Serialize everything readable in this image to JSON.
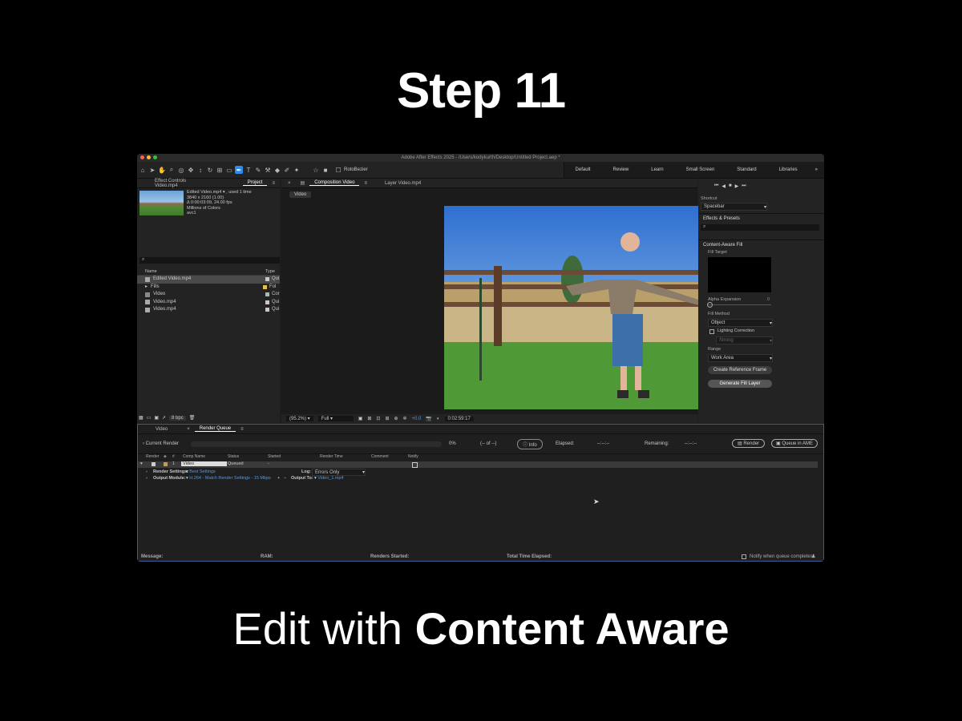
{
  "step_title": "Step 11",
  "caption": {
    "regular": "Edit with",
    "bold": "Content Aware"
  },
  "app": {
    "title": "Adobe After Effects 2025 - /Users/kodykurth/Desktop/Untitled Project.aep *",
    "toolbar": {
      "roto_label": "RotoBezier"
    },
    "workspaces": [
      "Default",
      "Review",
      "Learn",
      "Small Screen",
      "Standard",
      "Libraries"
    ],
    "project_panel": {
      "tabs": [
        "Effect Controls Video.mp4",
        "Project"
      ],
      "thumb_name": "Edited Video.mp4 ▾ , used 1 time",
      "thumb_info": [
        "3840 x 2160 (1.00)",
        "Δ 0:00:03:09, 24.00 fps",
        "Millions of Colors",
        "avc1"
      ],
      "col_name": "Name",
      "col_type": "Type",
      "items": [
        {
          "name": "Edited Video.mp4",
          "type": "Qui",
          "color": "#c8c8c8"
        },
        {
          "name": "Fills",
          "type": "Fol",
          "color": "#e2c24a"
        },
        {
          "name": "Video",
          "type": "Cor",
          "color": "#9ec0a6"
        },
        {
          "name": "Video.mp4",
          "type": "Qui",
          "color": "#c8c8c8"
        },
        {
          "name": "Video.mp4",
          "type": "Qui",
          "color": "#c8c8c8"
        }
      ],
      "bpc": "8 bpc"
    },
    "comp_panel": {
      "tabs": [
        "Composition Video",
        "Layer Video.mp4"
      ],
      "breadcrumb": "Video",
      "zoom": "(95.2%)",
      "quality": "Full",
      "exposure": "+0.0",
      "timecode": "0:02:59:17"
    },
    "right_panel": {
      "shortcut_label": "Shortcut",
      "shortcut_value": "Spacebar",
      "effects_title": "Effects & Presets",
      "caf_title": "Content-Aware Fill",
      "fill_target": "Fill Target",
      "alpha_expansion": "Alpha Expansion",
      "alpha_value": "0",
      "fill_method_label": "Fill Method",
      "fill_method": "Object",
      "lighting": "Lighting Correction",
      "strength": "Strong",
      "range_label": "Range",
      "range": "Work Area",
      "create_ref": "Create Reference Frame",
      "generate": "Generate Fill Layer"
    },
    "render_queue": {
      "tabs": [
        "Video",
        "Render Queue"
      ],
      "current_render": "Current Render",
      "percent": "0%",
      "of": "(-- of --)",
      "info": "Info",
      "elapsed_label": "Elapsed:",
      "elapsed_value": "--:--:--",
      "remaining_label": "Remaining:",
      "remaining_value": "--:--:--",
      "render_btn": "Render",
      "queue_ame": "Queue in AME",
      "headers": [
        "Render",
        "#",
        "Comp Name",
        "Status",
        "Started",
        "Render Time",
        "Comment",
        "Notify"
      ],
      "item": {
        "num": "1",
        "comp": "Video",
        "status": "Queued",
        "started": "-"
      },
      "render_settings_label": "Render Settings:",
      "render_settings_value": "Best Settings",
      "log_label": "Log:",
      "log_value": "Errors Only",
      "output_module_label": "Output Module:",
      "output_module_value": "H.264 - Match Render Settings - 15 Mbps",
      "output_to_label": "Output To:",
      "output_to_value": "Video_1.mp4"
    },
    "status_bar": {
      "message": "Message:",
      "ram": "RAM:",
      "renders_started": "Renders Started:",
      "total_time": "Total Time Elapsed:",
      "notify": "Notify when queue completes"
    }
  }
}
